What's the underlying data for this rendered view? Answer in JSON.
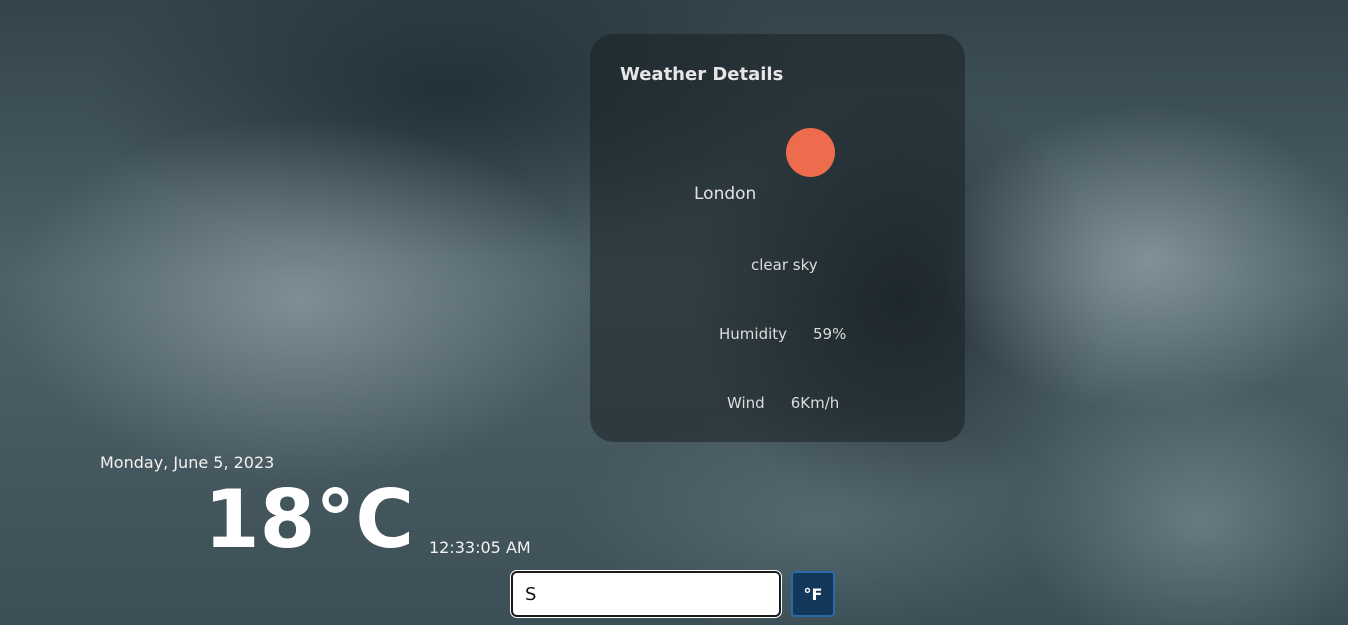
{
  "card": {
    "title": "Weather Details",
    "city": "London",
    "description": "clear sky",
    "humidity_label": "Humidity",
    "humidity_value": "59%",
    "wind_label": "Wind",
    "wind_value": "6Km/h",
    "icon": "sun-icon",
    "icon_color": "#ed6c4d"
  },
  "main": {
    "date": "Monday, June 5, 2023",
    "temperature": "18°C",
    "time": "12:33:05 AM"
  },
  "search": {
    "value": "S"
  },
  "unit_toggle": {
    "label": "°F"
  }
}
